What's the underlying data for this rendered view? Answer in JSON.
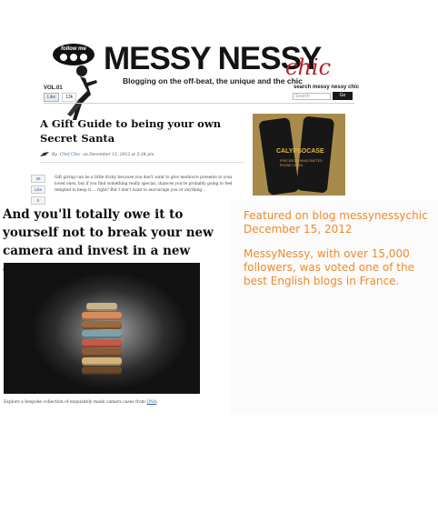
{
  "header": {
    "follow_label": "follow me",
    "logo_main": "MESSY NESSY",
    "logo_accent": "chic",
    "tagline": "Blogging on the off-beat, the unique and the chic",
    "volume": "VOL.01",
    "like_label": "Like",
    "like_count": "13k",
    "search_label": "search messy nessy chic",
    "search_placeholder": "Search",
    "search_button": "Go"
  },
  "post": {
    "title": "A Gift Guide to being your own Secret Santa",
    "meta_by": "By",
    "meta_author": "Chef Chic",
    "meta_date": "on December 15, 2012 at 5:34 pm",
    "share_count": "38",
    "share_like": "Like",
    "share_third": "0",
    "excerpt": "Gift giving can be a little tricky because you don't want to give mediocre presents to your loved ones, but if you find something really special, chances you're probably going to feel tempted to keep it ... right? But I don't want to encourage you or anything...",
    "big_headline": "And you'll totally owe it to yourself not to break your new camera and invest in a new camera case...",
    "caption_text": "Explore a bespoke collection of exquisitely made camera cases from",
    "caption_link": "ONA"
  },
  "ad": {
    "brand": "CALYPSOCASE",
    "sub": "PRECISION HANDCRAFTED PHONE CASES"
  },
  "note": {
    "featured_line1": "Featured on blog messynessychic",
    "featured_line2": "December 15, 2012",
    "description": "MessyNessy, with over 15,000 followers, was voted one of the best English blogs in France."
  },
  "colors": {
    "accent_red": "#b8212a",
    "note_orange": "#ef8a2c",
    "link_blue": "#2a5d9a"
  }
}
